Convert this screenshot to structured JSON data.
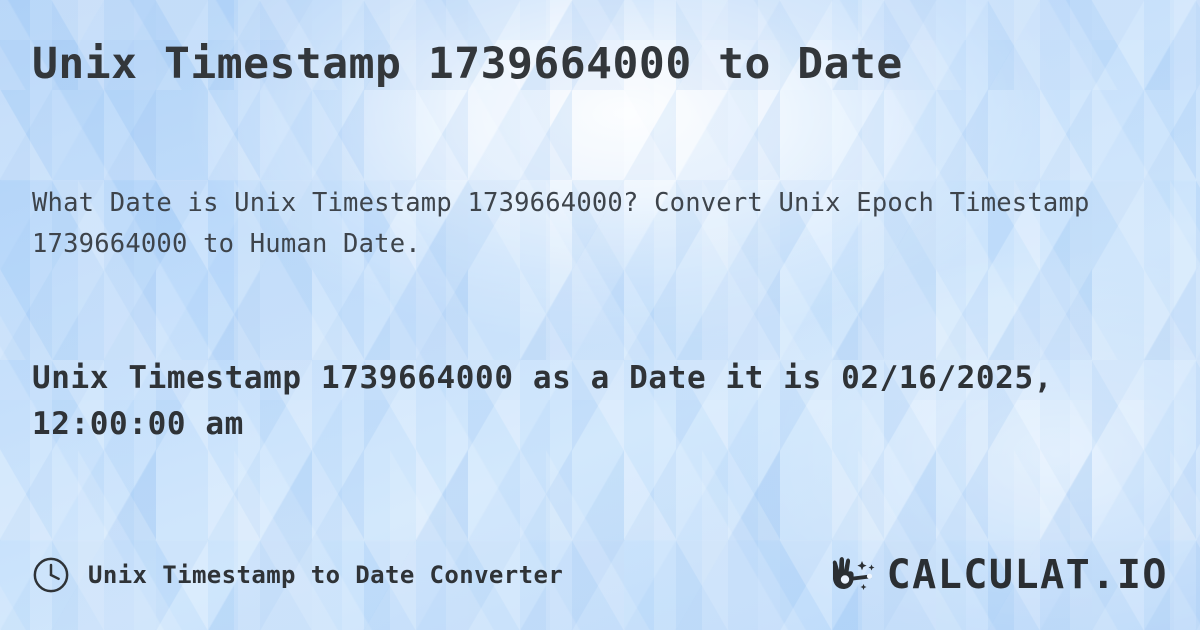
{
  "page": {
    "title": "Unix Timestamp 1739664000 to Date",
    "description": "What Date is Unix Timestamp 1739664000? Convert Unix Epoch Timestamp 1739664000 to Human Date.",
    "result": "Unix Timestamp 1739664000 as a Date it is 02/16/2025, 12:00:00 am"
  },
  "values": {
    "timestamp": "1739664000",
    "date": "02/16/2025",
    "time": "12:00:00 am"
  },
  "footer": {
    "clock_icon": "clock-icon",
    "label": "Unix Timestamp to Date Converter",
    "brand_icon": "magic-wand-hand-icon",
    "brand_name": "CALCULAT.IO"
  },
  "colors": {
    "title_text": "#33373b",
    "body_text": "#3e444b",
    "result_text": "#2f3337",
    "brand_text": "#2b2f33",
    "background_light": "#e9f3fe",
    "background_blue": "#abcff7",
    "background_mid": "#bfdcfb"
  }
}
